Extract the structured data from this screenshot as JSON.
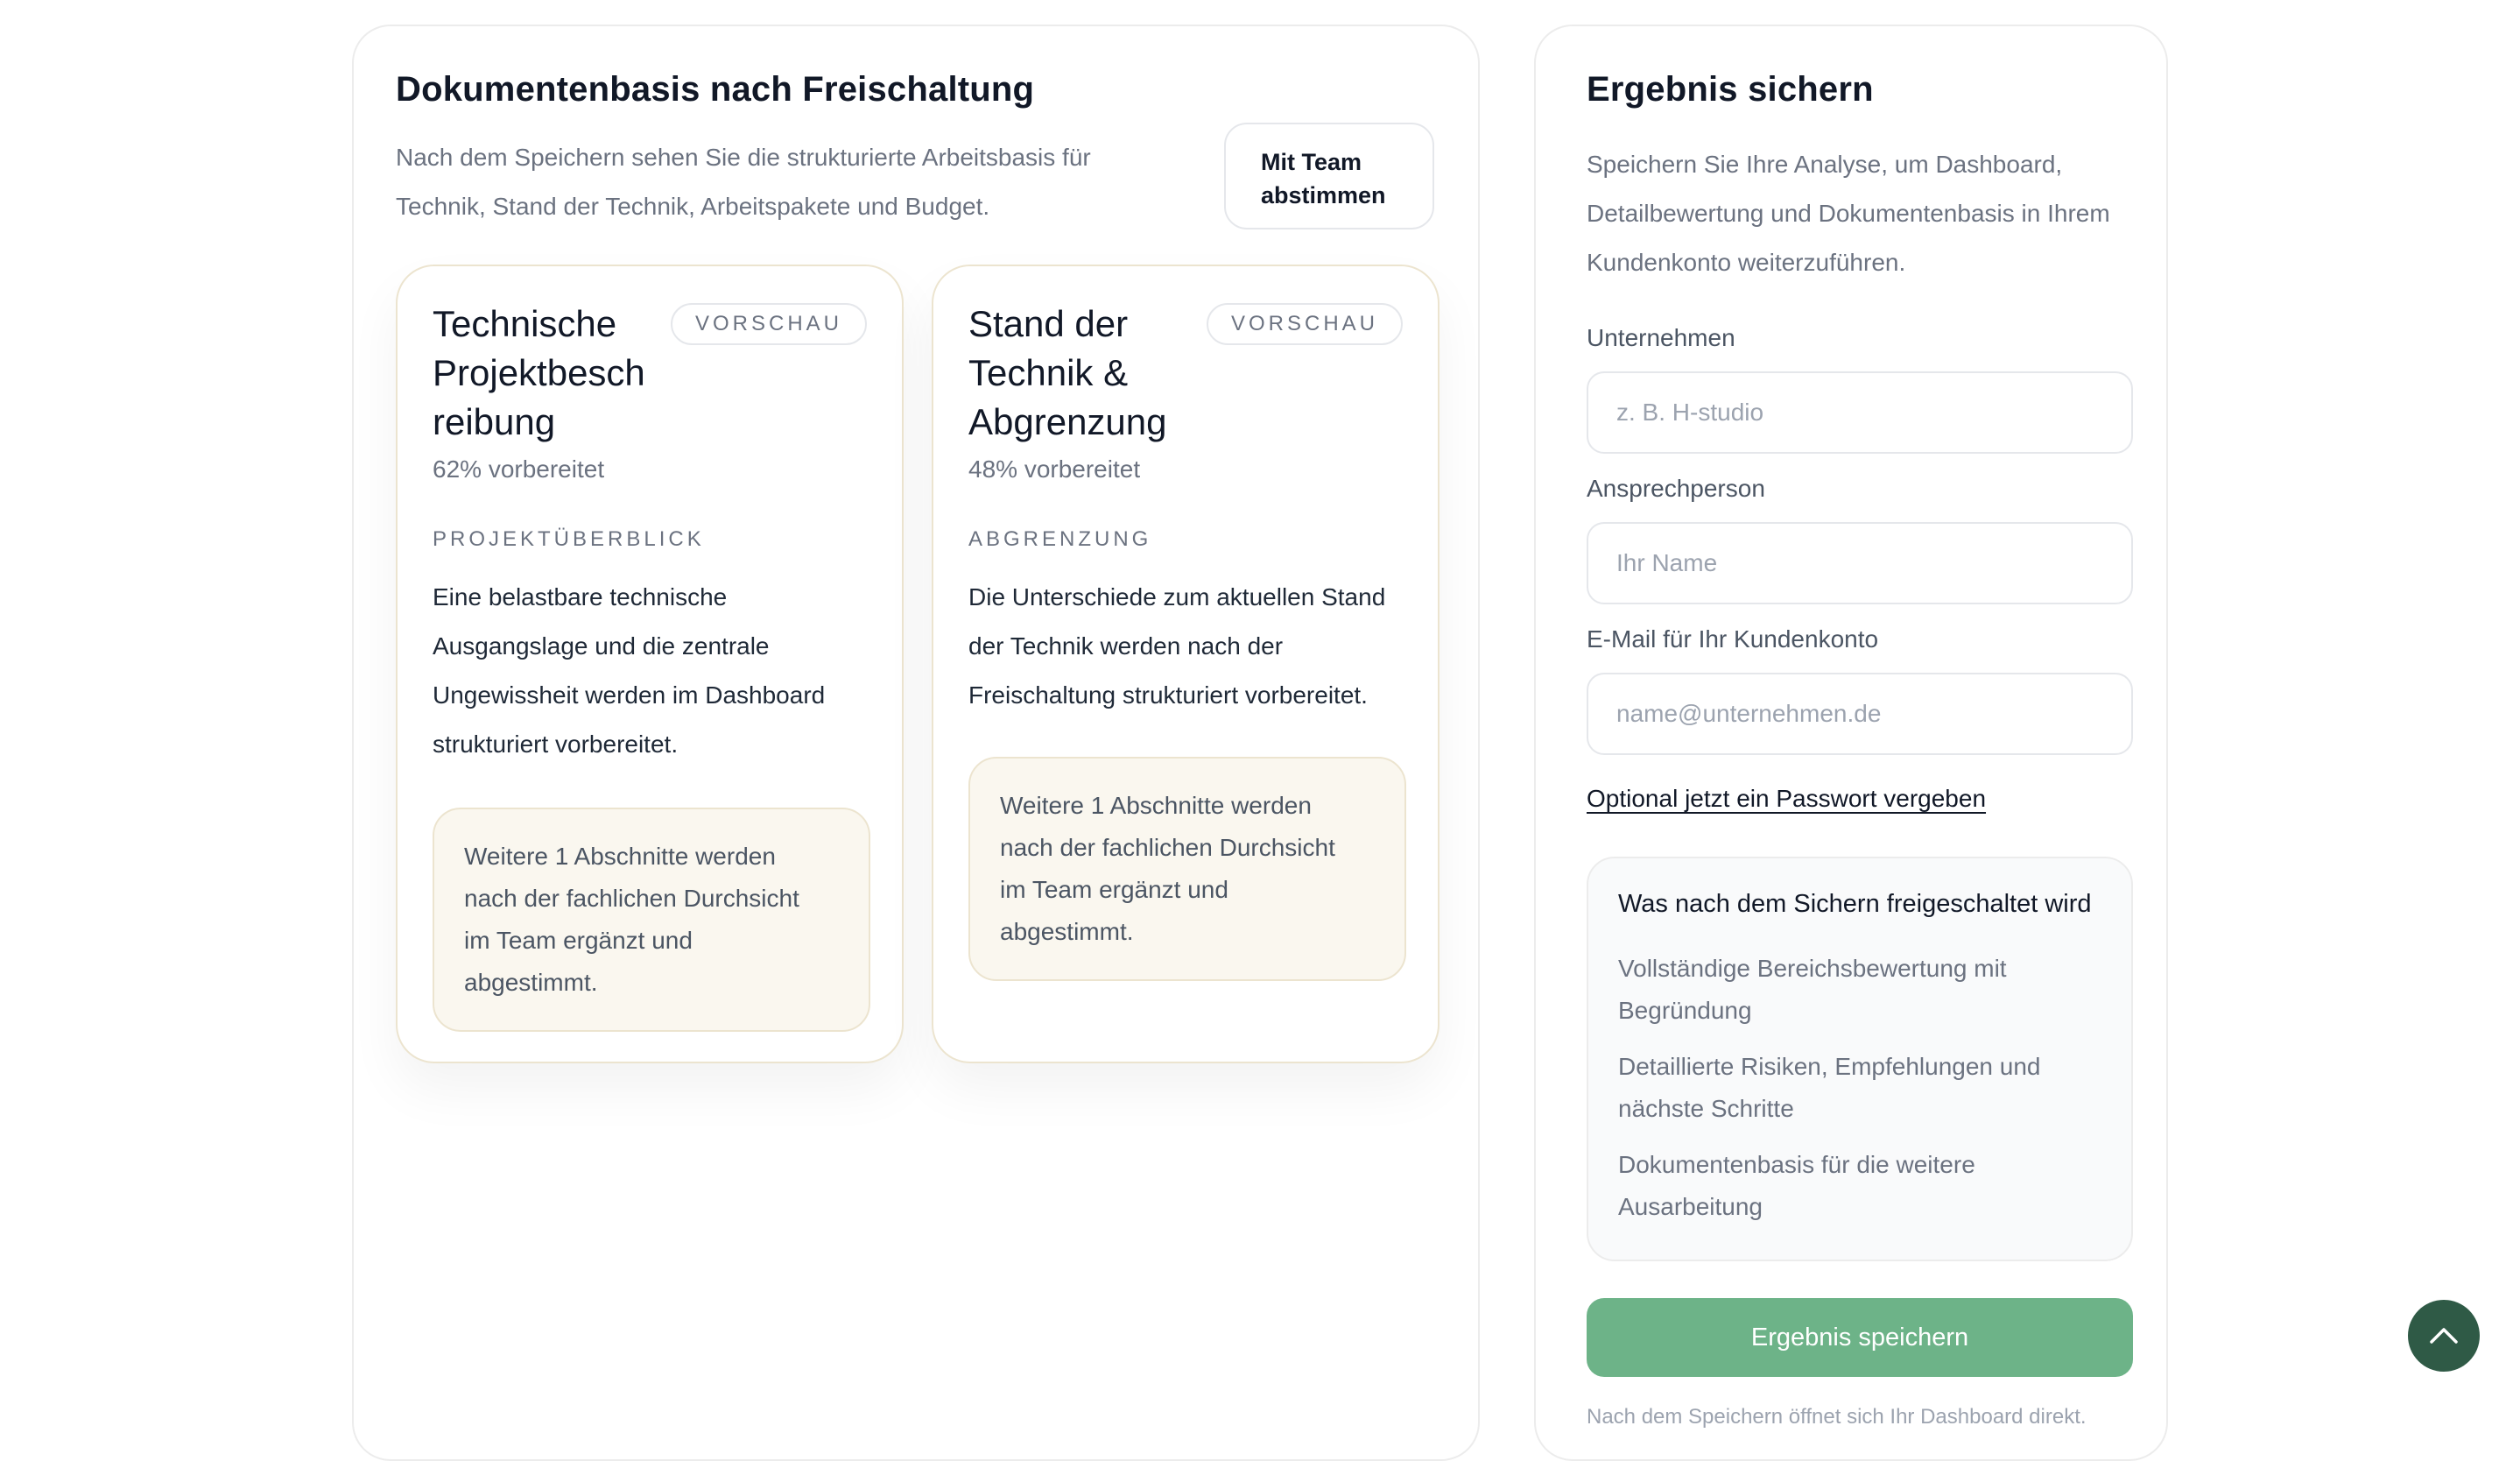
{
  "colors": {
    "accent_green": "#6db388",
    "scroll_button": "#2f5a46",
    "note_background": "#faf7ef",
    "card_border": "#ece4cf"
  },
  "documents": {
    "title": "Dokumentenbasis nach Freischaltung",
    "description_line1": "Nach dem Speichern sehen Sie die strukturierte Arbeitsbasis für",
    "description_line2": "Technik, Stand der Technik, Arbeitspakete und Budget.",
    "team_button_line1": "Mit Team",
    "team_button_line2": "abstimmen",
    "cards": [
      {
        "title_lines": [
          "Technische",
          "Projektbesch",
          "reibung"
        ],
        "badge": "VORSCHAU",
        "prepared": "62% vorbereitet",
        "progress_percent": 62,
        "eyebrow": "PROJEKTÜBERBLICK",
        "text_lines": [
          "Eine belastbare technische",
          "Ausgangslage und die zentrale",
          "Ungewissheit werden im Dashboard",
          "strukturiert vorbereitet."
        ],
        "note_lines": [
          "Weitere 1 Abschnitte werden",
          "nach der fachlichen Durchsicht",
          "im Team ergänzt und",
          "abgestimmt."
        ]
      },
      {
        "title_lines": [
          "Stand der",
          "Technik &",
          "Abgrenzung"
        ],
        "badge": "VORSCHAU",
        "prepared": "48% vorbereitet",
        "progress_percent": 48,
        "eyebrow": "ABGRENZUNG",
        "text_lines": [
          "Die Unterschiede zum aktuellen Stand",
          "der Technik werden nach der",
          "Freischaltung strukturiert vorbereitet."
        ],
        "note_lines": [
          "Weitere 1 Abschnitte werden",
          "nach der fachlichen Durchsicht",
          "im Team ergänzt und",
          "abgestimmt."
        ]
      }
    ]
  },
  "save": {
    "title": "Ergebnis sichern",
    "description_lines": [
      "Speichern Sie Ihre Analyse, um Dashboard,",
      "Detailbewertung und Dokumentenbasis in Ihrem",
      "Kundenkonto weiterzuführen."
    ],
    "fields": [
      {
        "label": "Unternehmen",
        "placeholder": "z. B. H-studio",
        "value": ""
      },
      {
        "label": "Ansprechperson",
        "placeholder": "Ihr Name",
        "value": ""
      },
      {
        "label": "E-Mail für Ihr Kundenkonto",
        "placeholder": "name@unternehmen.de",
        "value": ""
      }
    ],
    "password_link": "Optional jetzt ein Passwort vergeben",
    "unlock": {
      "title": "Was nach dem Sichern freigeschaltet wird",
      "items": [
        [
          "Vollständige Bereichsbewertung mit",
          "Begründung"
        ],
        [
          "Detaillierte Risiken, Empfehlungen und",
          "nächste Schritte"
        ],
        [
          "Dokumentenbasis für die weitere",
          "Ausarbeitung"
        ]
      ]
    },
    "button_label": "Ergebnis speichern",
    "after_save_text": "Nach dem Speichern öffnet sich Ihr Dashboard direkt."
  },
  "scroll_top_icon": "chevron-up-icon"
}
